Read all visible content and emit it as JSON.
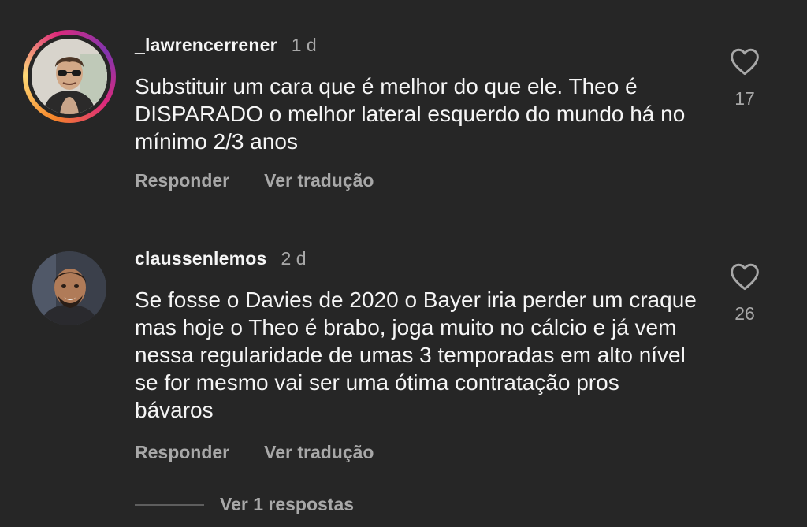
{
  "comments": [
    {
      "username": "_lawrencerrener",
      "time": "1 d",
      "text": "Substituir um cara que é melhor do que ele. Theo é DISPARADO o melhor lateral esquerdo do mundo há no mínimo 2/3 anos",
      "reply_label": "Responder",
      "translate_label": "Ver tradução",
      "likes": "17",
      "story_ring": true
    },
    {
      "username": "claussenlemos",
      "time": "2 d",
      "text": "Se fosse o Davies de 2020 o Bayer iria perder um craque mas hoje o Theo é brabo, joga muito no cálcio e já vem nessa regularidade de umas 3 temporadas em alto nível se for mesmo vai ser uma ótima contratação pros bávaros",
      "reply_label": "Responder",
      "translate_label": "Ver tradução",
      "likes": "26",
      "story_ring": false
    }
  ],
  "view_replies_label": "Ver 1 respostas",
  "colors": {
    "background": "#262626",
    "primary_text": "#f5f5f5",
    "secondary_text": "#a8a8a8"
  }
}
